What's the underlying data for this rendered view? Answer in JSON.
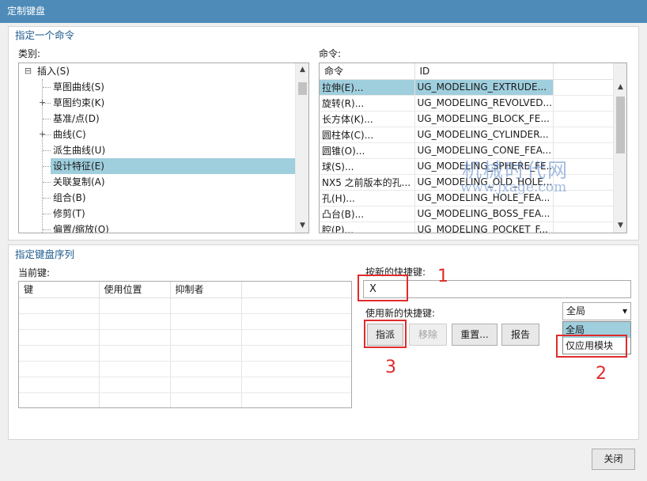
{
  "window": {
    "title": "定制键盘"
  },
  "specify_command": {
    "title": "指定一个命令",
    "category_label": "类别:",
    "command_label": "命令:",
    "tree": [
      {
        "label": "插入(S)",
        "expander": "⊟"
      },
      {
        "label": "草图曲线(S)",
        "expander": ""
      },
      {
        "label": "草图约束(K)",
        "expander": "+"
      },
      {
        "label": "基准/点(D)",
        "expander": ""
      },
      {
        "label": "曲线(C)",
        "expander": "+"
      },
      {
        "label": "派生曲线(U)",
        "expander": ""
      },
      {
        "label": "设计特征(E)",
        "expander": "",
        "selected": true
      },
      {
        "label": "关联复制(A)",
        "expander": ""
      },
      {
        "label": "组合(B)",
        "expander": ""
      },
      {
        "label": "修剪(T)",
        "expander": ""
      },
      {
        "label": "偏置/缩放(O)",
        "expander": ""
      }
    ],
    "commands_table": {
      "headers": [
        "命令",
        "ID"
      ],
      "rows": [
        {
          "cmd": "拉伸(E)...",
          "id": "UG_MODELING_EXTRUDE...",
          "selected": true
        },
        {
          "cmd": "旋转(R)...",
          "id": "UG_MODELING_REVOLVED..."
        },
        {
          "cmd": "长方体(K)...",
          "id": "UG_MODELING_BLOCK_FE..."
        },
        {
          "cmd": "圆柱体(C)...",
          "id": "UG_MODELING_CYLINDER..."
        },
        {
          "cmd": "圆锥(O)...",
          "id": "UG_MODELING_CONE_FEA..."
        },
        {
          "cmd": "球(S)...",
          "id": "UG_MODELING_SPHERE_FE..."
        },
        {
          "cmd": "NX5 之前版本的孔...",
          "id": "UG_MODELING_OLD_HOLE..."
        },
        {
          "cmd": "孔(H)...",
          "id": "UG_MODELING_HOLE_FEA..."
        },
        {
          "cmd": "凸台(B)...",
          "id": "UG_MODELING_BOSS_FEA..."
        },
        {
          "cmd": "腔(P)...",
          "id": "UG_MODELING_POCKET_F..."
        }
      ]
    }
  },
  "key_sequence": {
    "title": "指定键盘序列",
    "current_keys_label": "当前键:",
    "current_table": {
      "headers": [
        "键",
        "使用位置",
        "抑制者"
      ],
      "empty_rows": 7
    },
    "press_new_label": "按新的快捷键:",
    "new_key_value": "X",
    "use_new_label": "使用新的快捷键:",
    "scope": {
      "selected": "全局",
      "options": [
        "全局",
        "仅应用模块"
      ]
    },
    "buttons": {
      "assign": "指派",
      "remove": "移除",
      "reset": "重置...",
      "report": "报告"
    }
  },
  "annotations": [
    "1",
    "2",
    "3"
  ],
  "watermark": {
    "line1": "机械时代网",
    "line2": "www.jxage.com"
  },
  "footer": {
    "close": "关闭"
  },
  "icons": {
    "scroll_up": "▲",
    "scroll_down": "▼",
    "dropdown": "▾"
  },
  "colors": {
    "titlebar": "#4e8bb8",
    "selection": "#9fcedd",
    "annotation": "#e02b2b",
    "group_title": "#1e5a8c"
  }
}
